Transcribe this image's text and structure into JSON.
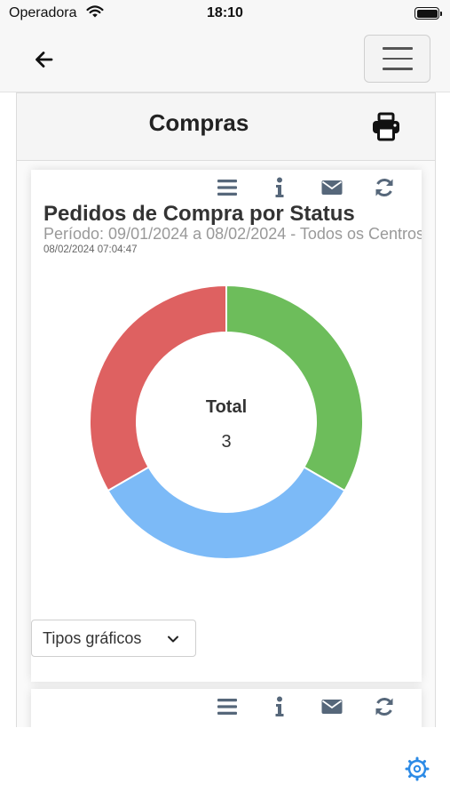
{
  "status_bar": {
    "carrier": "Operadora",
    "time": "18:10"
  },
  "header": {
    "back_icon": "arrow-left-icon",
    "menu_icon": "hamburger-icon"
  },
  "page": {
    "title": "Compras",
    "print_icon": "printer-icon"
  },
  "card": {
    "toolbar_icons": [
      "list-icon",
      "info-icon",
      "envelope-icon",
      "refresh-icon"
    ],
    "title": "Pedidos de Compra por Status",
    "subtitle": "Período: 09/01/2024 a 08/02/2024 - Todos os Centros",
    "timestamp": "08/02/2024 07:04:47",
    "center_label": "Total",
    "center_value": "3",
    "chart_type_dropdown": "Tipos gráficos"
  },
  "second_card": {
    "toolbar_icons": [
      "list-icon",
      "info-icon",
      "envelope-icon",
      "refresh-icon"
    ]
  },
  "colors": {
    "green": "#6dbd5b",
    "blue": "#7cbaf7",
    "red": "#de6161",
    "icon": "#56677a",
    "accent": "#2b8ae6"
  },
  "chart_data": {
    "type": "pie",
    "donut": true,
    "categories": [
      "",
      "",
      ""
    ],
    "values": [
      1,
      1,
      1
    ],
    "colors": [
      "#6dbd5b",
      "#7cbaf7",
      "#de6161"
    ],
    "total": 3
  }
}
